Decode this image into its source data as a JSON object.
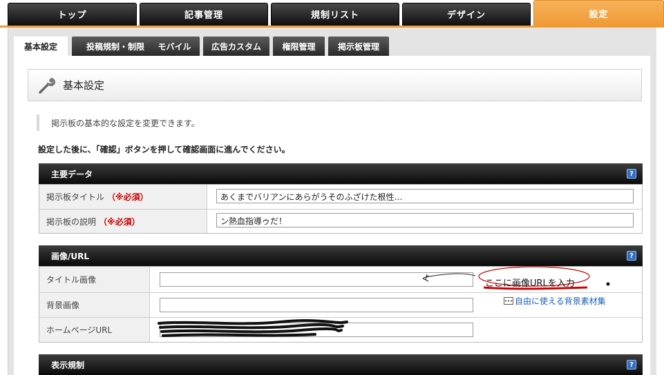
{
  "nav": {
    "tabs": [
      "トップ",
      "記事管理",
      "規制リスト",
      "デザイン",
      "設定"
    ],
    "active_color": "#ef9a35"
  },
  "subtabs": [
    "基本設定",
    "投稿規制・制限",
    "モバイル",
    "広告カスタム",
    "権限管理",
    "掲示板管理"
  ],
  "heading": {
    "icon": "wrench-icon",
    "title": "基本設定"
  },
  "note": "掲示板の基本的な設定を変更できます。",
  "instruction": "設定した後に、「確認」ボタンを押して確認画面に進んでください。",
  "sections": {
    "main": {
      "title": "主要データ",
      "rows": [
        {
          "label": "掲示板タイトル",
          "required": "（※必須）",
          "value": "あくまでバリアンにあらがうそのふざけた根性…"
        },
        {
          "label": "掲示板の説明",
          "required": "（※必須）",
          "value": "ン熱血指導ゥだ！"
        }
      ]
    },
    "image": {
      "title": "画像/URL",
      "rows": [
        {
          "label": "タイトル画像",
          "value": ""
        },
        {
          "label": "背景画像",
          "value": ""
        },
        {
          "label": "ホームページURL",
          "value": ""
        }
      ],
      "annotation": "ここに画像URLを入力",
      "bg_link": "自由に使える背景素材集"
    },
    "display": {
      "title": "表示規制"
    }
  },
  "help_label": "?"
}
